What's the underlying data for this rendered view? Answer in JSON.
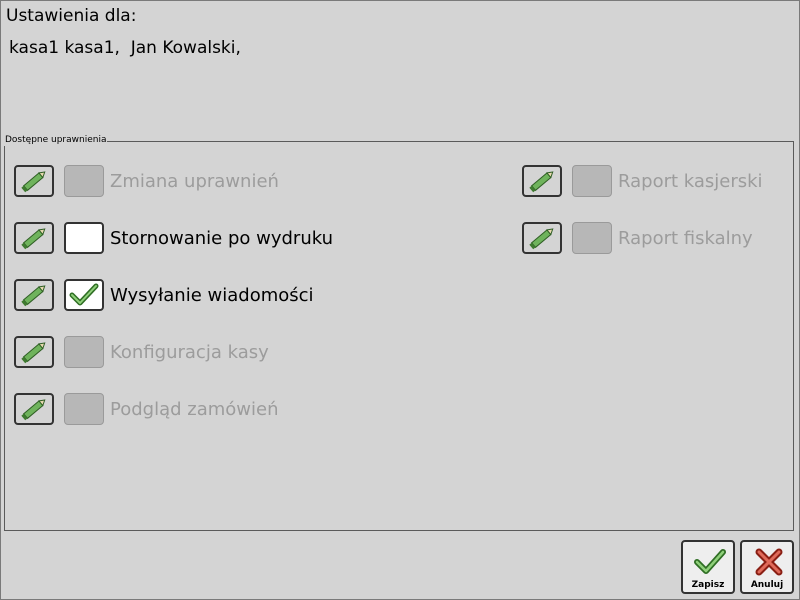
{
  "header": {
    "title": "Ustawienia dla:",
    "user": "kasa1 kasa1,  Jan Kowalski,"
  },
  "permissions_group": {
    "legend": "Dostępne uprawnienia",
    "items": [
      {
        "label": "Zmiana uprawnień",
        "enabled": false,
        "checked": false
      },
      {
        "label": "Stornowanie po wydruku",
        "enabled": true,
        "checked": false
      },
      {
        "label": "Wysyłanie wiadomości",
        "enabled": true,
        "checked": true
      },
      {
        "label": "Konfiguracja kasy",
        "enabled": false,
        "checked": false
      },
      {
        "label": "Podgląd zamówień",
        "enabled": false,
        "checked": false
      },
      {
        "label": "Raport kasjerski",
        "enabled": false,
        "checked": false
      },
      {
        "label": "Raport fiskalny",
        "enabled": false,
        "checked": false
      }
    ]
  },
  "actions": {
    "save_label": "Zapisz",
    "cancel_label": "Anuluj"
  },
  "icons": {
    "edit": "pencil-icon",
    "check": "checkmark-icon",
    "save": "checkmark-icon",
    "cancel": "close-icon"
  },
  "colors": {
    "background": "#d4d4d4",
    "disabled_text": "#9c9c9c",
    "icon_green": "#4a8c3a",
    "cancel_red": "#c0392b"
  }
}
